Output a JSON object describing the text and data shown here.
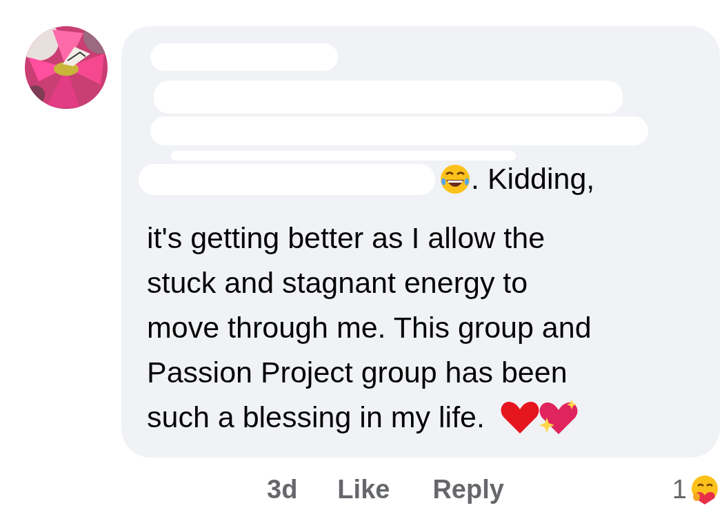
{
  "comment": {
    "lead_text": ". Kidding,",
    "lines": [
      "it's getting better as I allow the",
      "stuck and stagnant energy to",
      "move through me. This group and",
      "Passion Project group has been",
      "such a blessing in my life."
    ],
    "footer": {
      "age": "3d",
      "like": "Like",
      "reply": "Reply",
      "reaction_count": "1"
    }
  }
}
